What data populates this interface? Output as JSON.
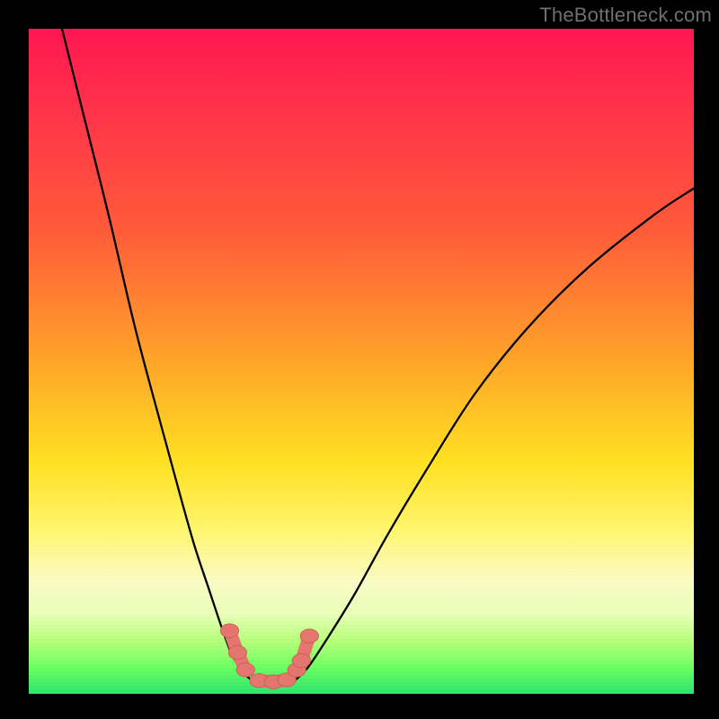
{
  "watermark": "TheBottleneck.com",
  "colors": {
    "frame": "#000000",
    "line": "#000000",
    "marker_fill": "#e5766f",
    "marker_stroke": "#c85a52",
    "gradient_top": "#ff1651",
    "gradient_mid": "#ffe021",
    "gradient_bottom": "#2be36b"
  },
  "chart_data": {
    "type": "line",
    "title": "",
    "xlabel": "",
    "ylabel": "",
    "xlim": [
      0,
      100
    ],
    "ylim": [
      0,
      100
    ],
    "grid": false,
    "legend": false,
    "note": "Tick labels not shown; x & y normalized 0–100. Values are percentage of plot-height from BOTTOM (curve dips to ~2 near the well).",
    "series": [
      {
        "name": "left-branch",
        "x": [
          5,
          8,
          12,
          16,
          20,
          23,
          25,
          27,
          29,
          30.5,
          32,
          33.2,
          34
        ],
        "y": [
          100,
          88,
          72,
          55,
          40,
          29,
          22,
          16,
          10,
          6,
          3.5,
          2.3,
          2
        ]
      },
      {
        "name": "well-floor",
        "x": [
          34,
          35,
          36,
          37,
          38,
          39,
          40
        ],
        "y": [
          2,
          1.8,
          1.7,
          1.7,
          1.7,
          1.8,
          2
        ]
      },
      {
        "name": "right-branch",
        "x": [
          40,
          42,
          45,
          49,
          54,
          60,
          67,
          75,
          84,
          94,
          100
        ],
        "y": [
          2,
          4,
          8.5,
          15,
          24,
          34,
          45,
          55,
          64,
          72,
          76
        ]
      }
    ],
    "markers": {
      "note": "salmon sausage-blob markers on the lower limbs of the V",
      "points_xy_from_bottom": [
        [
          30.2,
          9.5
        ],
        [
          31.4,
          6.2
        ],
        [
          32.6,
          3.6
        ],
        [
          34.6,
          2.0
        ],
        [
          36.8,
          1.8
        ],
        [
          38.8,
          2.1
        ],
        [
          40.3,
          3.6
        ],
        [
          41.0,
          5.0
        ],
        [
          42.2,
          8.7
        ]
      ],
      "radius_pct": 1.1
    }
  }
}
